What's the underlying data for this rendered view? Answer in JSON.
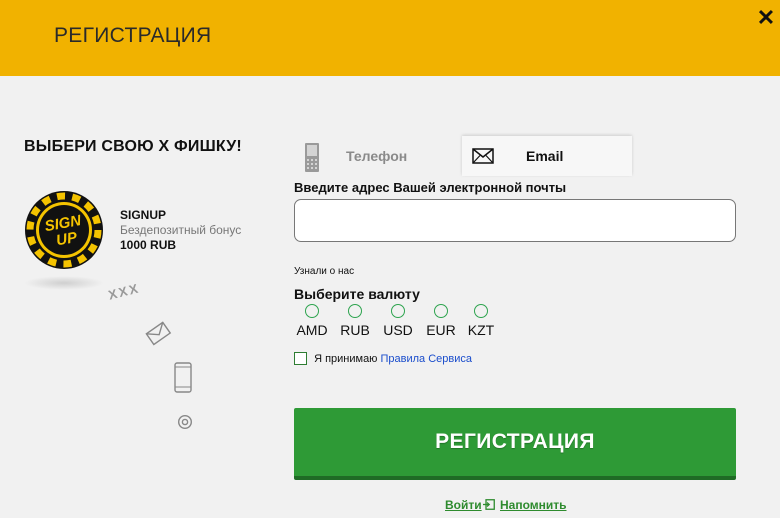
{
  "header": {
    "title": "РЕГИСТРАЦИЯ",
    "close_label": "✕"
  },
  "promo": {
    "title": "ВЫБЕРИ СВОЮ Х ФИШКУ!",
    "chip_line1": "SIGN",
    "chip_line2": "UP",
    "bonus_title": "SIGNUP",
    "bonus_desc": "Бездепозитный бонус",
    "bonus_amount": "1000 RUB",
    "xxx": "XXX",
    "icons": [
      "xxx-icon",
      "envelope-icon",
      "phone-icon",
      "at-icon"
    ]
  },
  "tabs": [
    {
      "label": "Телефон",
      "icon": "phone-icon",
      "active": false
    },
    {
      "label": "Email",
      "icon": "envelope-icon",
      "active": true
    }
  ],
  "form": {
    "email_label": "Введите адрес Вашей электронной почты",
    "email_value": "",
    "heard_label": "Узнали о нас",
    "currency_label": "Выберите валюту",
    "currencies": [
      "AMD",
      "RUB",
      "USD",
      "EUR",
      "KZT"
    ],
    "terms_prefix": "Я принимаю",
    "terms_link": "Правила Сервиса",
    "submit_label": "РЕГИСТРАЦИЯ"
  },
  "links": {
    "login": "Войти",
    "remind": "Напомнить"
  },
  "colors": {
    "header": "#f1b200",
    "accent_green": "#2e9a36",
    "link_blue": "#1a4dcc"
  }
}
